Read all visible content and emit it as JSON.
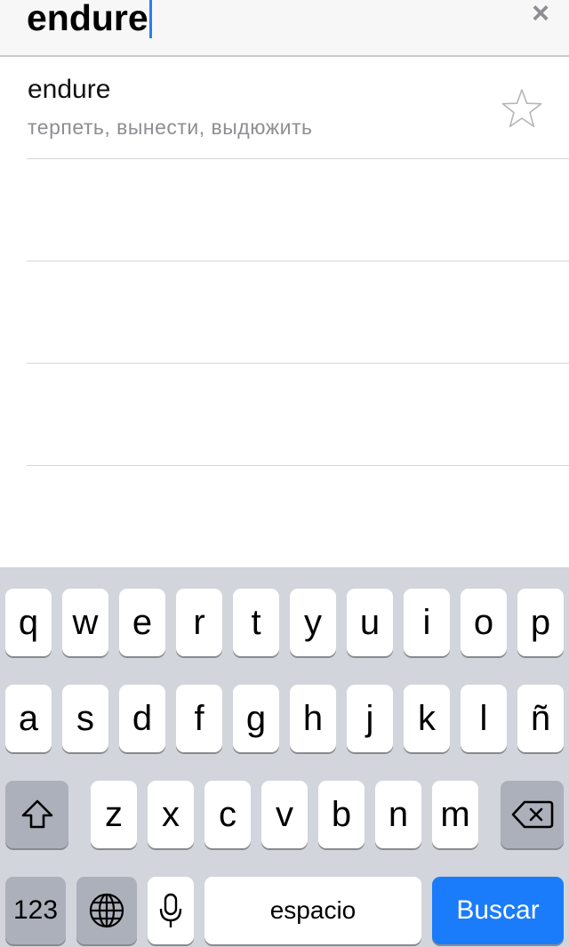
{
  "search": {
    "query": "endure",
    "clear_icon": "x-icon"
  },
  "results": [
    {
      "word": "endure",
      "translation": "терпеть, вынести, выдюжить",
      "favorite_icon": "star-outline-icon"
    }
  ],
  "keyboard": {
    "row1": [
      "q",
      "w",
      "e",
      "r",
      "t",
      "y",
      "u",
      "i",
      "o",
      "p"
    ],
    "row2": [
      "a",
      "s",
      "d",
      "f",
      "g",
      "h",
      "j",
      "k",
      "l",
      "ñ"
    ],
    "row3": [
      "z",
      "x",
      "c",
      "v",
      "b",
      "n",
      "m"
    ],
    "numbers_label": "123",
    "space_label": "espacio",
    "return_label": "Buscar",
    "icons": [
      "shift-icon",
      "backspace-icon",
      "globe-icon",
      "microphone-icon"
    ]
  },
  "colors": {
    "accent": "#1a7cfa",
    "caret": "#2c7cf6",
    "keyboard_bg": "#d2d5db",
    "dark_key": "#abb0ba",
    "secondary_text": "#8e8e93"
  }
}
